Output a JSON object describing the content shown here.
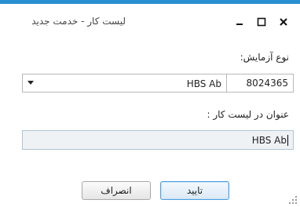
{
  "window": {
    "title": "لیست کار - خدمت جدید",
    "close_icon": "close-icon",
    "maximize_icon": "maximize-icon",
    "minimize_icon": "minimize-icon",
    "accent_color": "#2a8fd0"
  },
  "form": {
    "test_type_label": "نوع آزمایش:",
    "test_code_value": "8024365",
    "test_name_value": "HBS Ab",
    "worklist_title_label": "عنوان در لیست کار :",
    "worklist_title_value": "HBS Ab"
  },
  "buttons": {
    "confirm_label": "تایید",
    "cancel_label": "انصراف"
  }
}
